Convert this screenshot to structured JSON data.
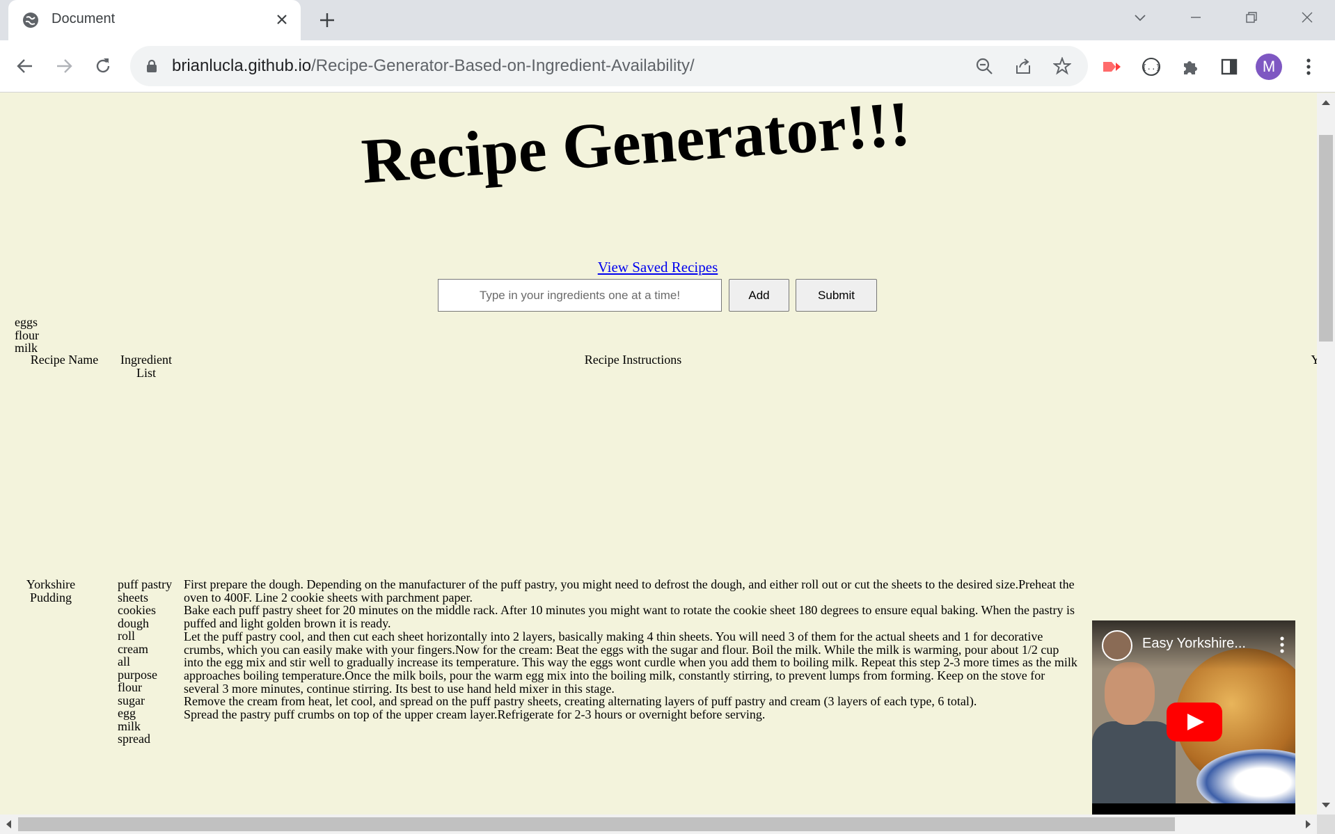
{
  "browser": {
    "tab_title": "Document",
    "url_host": "brianlucla.github.io",
    "url_path": "/Recipe-Generator-Based-on-Ingredient-Availability/",
    "avatar_initial": "M"
  },
  "page": {
    "title": "Recipe Generator!!!",
    "saved_link": "View Saved Recipes",
    "input_placeholder": "Type in your ingredients one at a time!",
    "add_label": "Add",
    "submit_label": "Submit",
    "entered_ingredients": [
      "eggs",
      "flour",
      "milk"
    ]
  },
  "table": {
    "headers": {
      "name": "Recipe Name",
      "ingredients": "Ingredient List",
      "instructions": "Recipe Instructions",
      "partial": "Y"
    },
    "rows": [
      {
        "name": "Yorkshire Pudding",
        "ingredients": [
          "puff pastry",
          "sheets",
          "cookies",
          "dough",
          "roll",
          "cream",
          "all",
          "purpose",
          "flour",
          "sugar",
          "egg",
          "milk",
          "spread"
        ],
        "instructions": [
          "First prepare the dough. Depending on the manufacturer of the puff pastry, you might need to defrost the dough, and either roll out or cut the sheets to the desired size.Preheat the oven to 400F. Line 2 cookie sheets with parchment paper.",
          "Bake each puff pastry sheet for 20 minutes on the middle rack. After 10 minutes you might want to rotate the cookie sheet 180 degrees to ensure equal baking. When the pastry is puffed and light golden brown it is ready.",
          "Let the puff pastry cool, and then cut each sheet horizontally into 2 layers, basically making 4 thin sheets. You will need 3 of them for the actual sheets and 1 for decorative crumbs, which you can easily make with your fingers.Now for the cream: Beat the eggs with the sugar and flour. Boil the milk. While the milk is warming, pour about 1/2 cup into the egg mix and stir well to gradually increase its temperature. This way the eggs wont curdle when you add them to boiling milk. Repeat this step 2-3 more times as the milk approaches boiling temperature.Once the milk boils, pour the warm egg mix into the boiling milk, constantly stirring, to prevent lumps from forming. Keep on the stove for several 3 more minutes, continue stirring. Its best to use hand held mixer in this stage.",
          "Remove the cream from heat, let cool, and spread on the puff pastry sheets, creating alternating layers of puff pastry and cream (3 layers of each type, 6 total).",
          "Spread the pastry puff crumbs on top of the upper cream layer.Refrigerate for 2-3 hours or overnight before serving."
        ],
        "video_title": "Easy Yorkshire..."
      }
    ]
  },
  "icons": {
    "tab": "globe-icon",
    "close": "close-icon",
    "new_tab": "plus-icon",
    "back": "back-arrow-icon",
    "forward": "forward-arrow-icon",
    "reload": "reload-icon",
    "lock": "lock-icon",
    "zoom": "zoom-out-icon",
    "share": "share-icon",
    "bookmark": "star-icon",
    "extensions": "puzzle-icon",
    "side_panel": "side-panel-icon",
    "menu": "kebab-menu-icon"
  },
  "colors": {
    "page_background": "#f3f3dc",
    "link": "#0000ee",
    "avatar": "#7e57c2",
    "youtube_play": "#ff0000"
  }
}
